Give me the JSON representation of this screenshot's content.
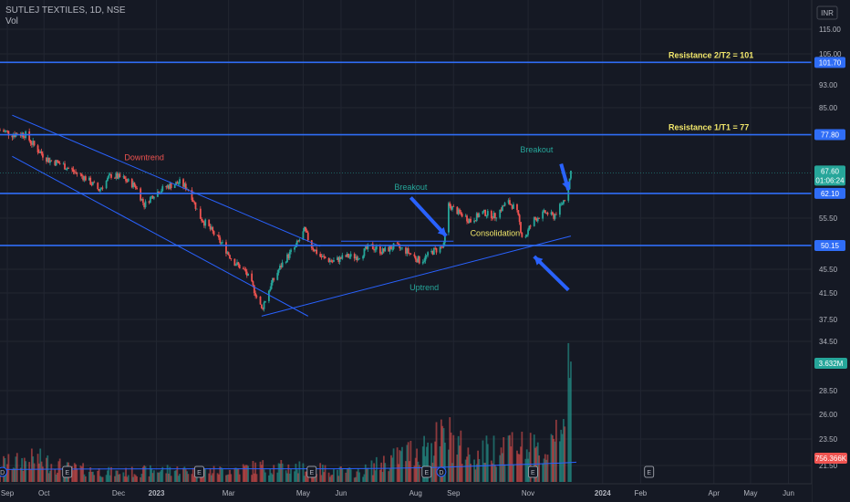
{
  "chart_data": {
    "type": "candlestick",
    "symbol_line": "SUTLEJ TEXTILES, 1D, NSE",
    "volume_label": "Vol",
    "currency": "INR",
    "ylim": [
      20,
      122
    ],
    "y_ticks": [
      115,
      105,
      93,
      85,
      55.5,
      45.5,
      41.5,
      37.5,
      34.5,
      28.5,
      26,
      23.5,
      21.5
    ],
    "y_tick_labels": [
      "115.00",
      "105.00",
      "93.00",
      "85.00",
      "55.50",
      "45.50",
      "41.50",
      "37.50",
      "34.50",
      "28.50",
      "26.00",
      "23.50",
      "21.50"
    ],
    "y_map_points": [
      [
        115,
        32
      ],
      [
        105,
        59
      ],
      [
        93,
        93
      ],
      [
        85,
        118
      ],
      [
        55.5,
        239
      ],
      [
        45.5,
        295
      ],
      [
        41.5,
        321
      ],
      [
        37.5,
        350
      ],
      [
        34.5,
        374
      ],
      [
        28.5,
        428
      ],
      [
        26,
        454
      ],
      [
        23.5,
        481
      ],
      [
        21.5,
        510
      ]
    ],
    "x_ticks": [
      "Sep",
      "Oct",
      "Dec",
      "2023",
      "Mar",
      "May",
      "Jun",
      "Aug",
      "Sep",
      "Nov",
      "2024",
      "Feb",
      "Apr",
      "May",
      "Jun"
    ],
    "x_tick_dates": [
      "2022-09-01",
      "2022-10-01",
      "2022-12-01",
      "2023-01-01",
      "2023-03-01",
      "2023-05-01",
      "2023-06-01",
      "2023-08-01",
      "2023-09-01",
      "2023-11-01",
      "2024-01-01",
      "2024-02-01",
      "2024-04-01",
      "2024-05-01",
      "2024-06-01"
    ],
    "x_range": [
      "2022-08-26",
      "2024-06-20"
    ],
    "price_points": [
      [
        "2022-08-26",
        79
      ],
      [
        "2022-09-05",
        78
      ],
      [
        "2022-09-15",
        78
      ],
      [
        "2022-09-25",
        74
      ],
      [
        "2022-10-05",
        71
      ],
      [
        "2022-10-15",
        70
      ],
      [
        "2022-10-25",
        68
      ],
      [
        "2022-11-05",
        66
      ],
      [
        "2022-11-15",
        63
      ],
      [
        "2022-11-25",
        67
      ],
      [
        "2022-12-05",
        66
      ],
      [
        "2022-12-15",
        64
      ],
      [
        "2022-12-22",
        59
      ],
      [
        "2022-12-30",
        62
      ],
      [
        "2023-01-10",
        64
      ],
      [
        "2023-01-20",
        65
      ],
      [
        "2023-01-28",
        63
      ],
      [
        "2023-02-05",
        56
      ],
      [
        "2023-02-15",
        53
      ],
      [
        "2023-02-25",
        50
      ],
      [
        "2023-03-05",
        47
      ],
      [
        "2023-03-15",
        45
      ],
      [
        "2023-03-22",
        42
      ],
      [
        "2023-03-28",
        39
      ],
      [
        "2023-04-05",
        43
      ],
      [
        "2023-04-15",
        47
      ],
      [
        "2023-04-25",
        50
      ],
      [
        "2023-05-02",
        53
      ],
      [
        "2023-05-08",
        50
      ],
      [
        "2023-05-15",
        48
      ],
      [
        "2023-05-25",
        47
      ],
      [
        "2023-06-05",
        48
      ],
      [
        "2023-06-15",
        48
      ],
      [
        "2023-06-25",
        50
      ],
      [
        "2023-07-05",
        49
      ],
      [
        "2023-07-15",
        50
      ],
      [
        "2023-07-25",
        49
      ],
      [
        "2023-08-05",
        47
      ],
      [
        "2023-08-15",
        49
      ],
      [
        "2023-08-24",
        50
      ],
      [
        "2023-08-28",
        59
      ],
      [
        "2023-09-05",
        57
      ],
      [
        "2023-09-15",
        55
      ],
      [
        "2023-09-25",
        57
      ],
      [
        "2023-10-05",
        56
      ],
      [
        "2023-10-15",
        60
      ],
      [
        "2023-10-22",
        58
      ],
      [
        "2023-10-28",
        51
      ],
      [
        "2023-11-05",
        55
      ],
      [
        "2023-11-15",
        57
      ],
      [
        "2023-11-22",
        56
      ],
      [
        "2023-11-28",
        59
      ],
      [
        "2023-12-03",
        62
      ],
      [
        "2023-12-06",
        68
      ]
    ],
    "volume_points": [
      [
        "2022-09-01",
        1.2
      ],
      [
        "2022-09-25",
        1.5
      ],
      [
        "2022-10-20",
        0.9
      ],
      [
        "2022-12-01",
        0.6
      ],
      [
        "2023-01-10",
        0.8
      ],
      [
        "2023-02-15",
        0.7
      ],
      [
        "2023-03-28",
        1.0
      ],
      [
        "2023-05-02",
        0.9
      ],
      [
        "2023-06-15",
        0.6
      ],
      [
        "2023-08-28",
        3.0
      ],
      [
        "2023-09-15",
        1.6
      ],
      [
        "2023-10-15",
        2.6
      ],
      [
        "2023-11-15",
        1.8
      ],
      [
        "2023-12-06",
        6.4
      ]
    ],
    "volume_max": 6.6,
    "volume_ma": 0.756,
    "horizontal_levels": [
      {
        "value": 101.7,
        "label": "101.70",
        "note": "Resistance 2/T2 = 101"
      },
      {
        "value": 77.8,
        "label": "77.80",
        "note": "Resistance 1/T1 = 77"
      },
      {
        "value": 62.1,
        "label": "62.10",
        "note": ""
      },
      {
        "value": 50.15,
        "label": "50.15",
        "note": ""
      }
    ],
    "current_price": {
      "value": 67.6,
      "label": "67.60",
      "countdown": "01:06:24"
    },
    "volume_badges": [
      {
        "label": "3.632M",
        "color": "#26a69a"
      },
      {
        "label": "756.366K",
        "color": "#ef5350"
      }
    ],
    "trendlines": [
      {
        "from": [
          "2022-09-05",
          83
        ],
        "to": [
          "2023-05-15",
          50
        ]
      },
      {
        "from": [
          "2022-09-05",
          72
        ],
        "to": [
          "2023-05-05",
          38
        ]
      },
      {
        "from": [
          "2023-03-28",
          38
        ],
        "to": [
          "2023-12-06",
          52
        ]
      }
    ],
    "box_lines": [
      {
        "from": [
          "2023-06-01",
          51
        ],
        "to": [
          "2023-09-01",
          51
        ]
      },
      {
        "from": [
          "2023-08-28",
          62.1
        ],
        "to": [
          "2023-12-06",
          62.1
        ]
      }
    ],
    "annotations": [
      {
        "text": "Downtrend",
        "at": [
          "2022-12-22",
          71
        ],
        "color": "#ef5350"
      },
      {
        "text": "Breakout",
        "at": [
          "2023-07-28",
          63
        ],
        "color": "#26a69a"
      },
      {
        "text": "Consolidation",
        "at": [
          "2023-10-05",
          52
        ],
        "color": "#f2e76b"
      },
      {
        "text": "Uptrend",
        "at": [
          "2023-08-08",
          42
        ],
        "color": "#26a69a"
      },
      {
        "text": "Breakout",
        "at": [
          "2023-11-08",
          73
        ],
        "color": "#26a69a"
      }
    ],
    "arrows": [
      {
        "from": [
          "2023-07-28",
          61
        ],
        "to": [
          "2023-08-26",
          52
        ]
      },
      {
        "from": [
          "2023-11-28",
          70
        ],
        "to": [
          "2023-12-04",
          63
        ]
      },
      {
        "from": [
          "2023-12-04",
          42
        ],
        "to": [
          "2023-11-06",
          48
        ]
      }
    ],
    "event_markers": [
      {
        "date": "2022-08-28",
        "text": "D"
      },
      {
        "date": "2022-10-20",
        "text": "E"
      },
      {
        "date": "2023-02-05",
        "text": "E"
      },
      {
        "date": "2023-05-08",
        "text": "E"
      },
      {
        "date": "2023-08-10",
        "text": "E"
      },
      {
        "date": "2023-08-22",
        "text": "D"
      },
      {
        "date": "2023-11-05",
        "text": "E"
      },
      {
        "date": "2024-02-08",
        "text": "E"
      }
    ],
    "colors": {
      "bg": "#151924",
      "grid": "#222631",
      "text": "#b2b5be",
      "up": "#26a69a",
      "down": "#ef5350",
      "line": "#2962ff",
      "level": "#2f6df6",
      "note": "#f2e76b"
    },
    "grid": true
  }
}
